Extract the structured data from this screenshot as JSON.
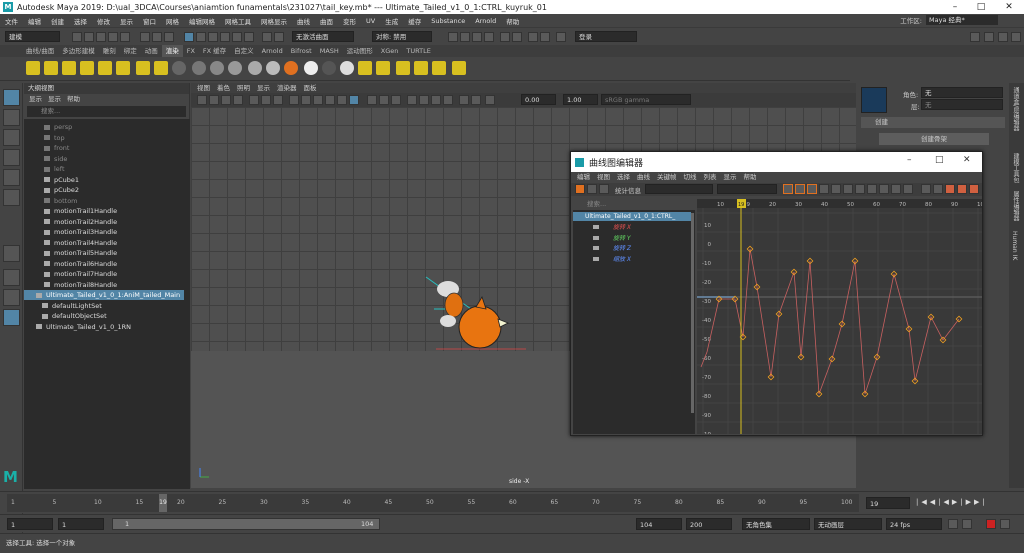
{
  "app": {
    "title": "Autodesk Maya 2019: D:\\ual_3DCA\\Courses\\aniamtion funamentals\\231027\\tail_key.mb*   ---   Ultimate_Tailed_v1_0_1:CTRL_kuyruk_01"
  },
  "menubar": [
    "文件",
    "编辑",
    "创建",
    "选择",
    "修改",
    "显示",
    "窗口",
    "网格",
    "编辑网格",
    "网格工具",
    "网格显示",
    "曲线",
    "曲面",
    "变形",
    "UV",
    "生成",
    "缓存",
    "Substance",
    "Arnold",
    "帮助"
  ],
  "workspace": {
    "label": "工作区:",
    "value": "Maya 经典*"
  },
  "statusline": {
    "mode": "建模",
    "no_live": "无激活曲面",
    "symmetry": "对称: 禁用",
    "login": "登录"
  },
  "shelf_tabs": [
    "曲线/曲面",
    "多边形建模",
    "雕刻",
    "绑定",
    "动画",
    "渲染",
    "FX",
    "FX 缓存",
    "自定义",
    "Arnold",
    "Bifrost",
    "MASH",
    "运动图形",
    "XGen",
    "TURTLE"
  ],
  "shelf_active": "渲染",
  "outliner": {
    "title": "大纲视图",
    "menu": [
      "显示",
      "显示",
      "帮助"
    ],
    "search_placeholder": "搜索...",
    "items": [
      {
        "label": "persp",
        "kind": "cam"
      },
      {
        "label": "top",
        "kind": "cam"
      },
      {
        "label": "front",
        "kind": "cam"
      },
      {
        "label": "side",
        "kind": "cam"
      },
      {
        "label": "left",
        "kind": "cam"
      },
      {
        "label": "pCube1",
        "kind": "mesh"
      },
      {
        "label": "pCube2",
        "kind": "mesh"
      },
      {
        "label": "bottom",
        "kind": "cam"
      },
      {
        "label": "motionTrail1Handle",
        "kind": "trail"
      },
      {
        "label": "motionTrail2Handle",
        "kind": "trail"
      },
      {
        "label": "motionTrail3Handle",
        "kind": "trail"
      },
      {
        "label": "motionTrail4Handle",
        "kind": "trail"
      },
      {
        "label": "motionTrail5Handle",
        "kind": "trail"
      },
      {
        "label": "motionTrail6Handle",
        "kind": "trail"
      },
      {
        "label": "motionTrail7Handle",
        "kind": "trail"
      },
      {
        "label": "motionTrail8Handle",
        "kind": "trail"
      },
      {
        "label": "Ultimate_Tailed_v1_0_1:AniM_tailed_Main",
        "kind": "sel"
      },
      {
        "label": "defaultLightSet",
        "kind": "set"
      },
      {
        "label": "defaultObjectSet",
        "kind": "set"
      },
      {
        "label": "Ultimate_Tailed_v1_0_1RN",
        "kind": "ref"
      }
    ]
  },
  "viewport": {
    "menu": [
      "视图",
      "着色",
      "照明",
      "显示",
      "渲染器",
      "面板"
    ],
    "val1": "0.00",
    "val2": "1.00",
    "colorspace": "sRGB gamma",
    "caption": "side -X"
  },
  "graph_editor": {
    "title": "曲线图编辑器",
    "menu": [
      "编辑",
      "视图",
      "选择",
      "曲线",
      "关键帧",
      "切线",
      "列表",
      "显示",
      "帮助"
    ],
    "stats_label": "统计信息",
    "search_placeholder": "搜索...",
    "node": "Ultimate_Tailed_v1_0_1:CTRL_",
    "channels": [
      {
        "label": "旋转 X",
        "color": "#e05050"
      },
      {
        "label": "旋转 Y",
        "color": "#60d060"
      },
      {
        "label": "旋转 Z",
        "color": "#6090ff"
      },
      {
        "label": "缩放 X",
        "color": "#6090ff"
      }
    ],
    "ruler_labels": [
      "10",
      "19",
      "20",
      "30",
      "40",
      "50",
      "60",
      "70",
      "80",
      "90",
      "10"
    ],
    "y_labels": [
      "10",
      "0",
      "-10",
      "-20",
      "-30",
      "-40",
      "-50",
      "-60",
      "-70",
      "-80",
      "-90",
      "-10"
    ],
    "current_frame": "19"
  },
  "channel_box": {
    "role_label": "角色:",
    "role_value": "无",
    "layer_label": "层:",
    "layer_value": "无",
    "section": "创建",
    "create_button": "创建骨架"
  },
  "side_tabs": [
    "通道盒/层编辑器",
    "建模工具包",
    "属性编辑器",
    "Human IK"
  ],
  "time_slider": {
    "ticks": [
      "1",
      "5",
      "10",
      "15",
      "20",
      "25",
      "30",
      "35",
      "40",
      "45",
      "50",
      "55",
      "60",
      "65",
      "70",
      "75",
      "80",
      "85",
      "90",
      "95",
      "100"
    ],
    "current": "19",
    "current_field": "19"
  },
  "range_slider": {
    "start": "1",
    "anim_start": "1",
    "range_start": "1",
    "range_end": "104",
    "anim_end": "104",
    "end": "200",
    "char_set": "无角色集",
    "anim_layer": "无动画层",
    "fps": "24 fps"
  },
  "helpline": {
    "text": "选择工具: 选择一个对象"
  }
}
